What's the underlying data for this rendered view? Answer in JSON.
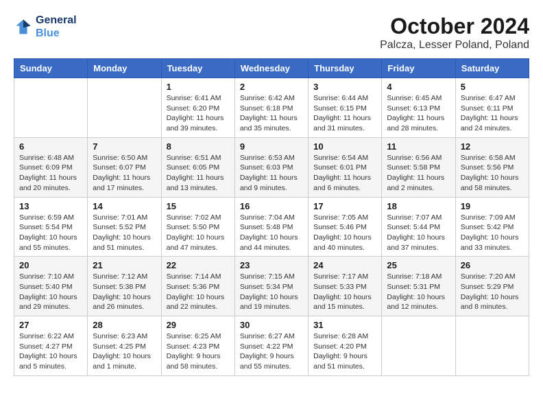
{
  "header": {
    "logo_line1": "General",
    "logo_line2": "Blue",
    "month_title": "October 2024",
    "location": "Palcza, Lesser Poland, Poland"
  },
  "columns": [
    "Sunday",
    "Monday",
    "Tuesday",
    "Wednesday",
    "Thursday",
    "Friday",
    "Saturday"
  ],
  "weeks": [
    [
      {
        "day": "",
        "info": ""
      },
      {
        "day": "",
        "info": ""
      },
      {
        "day": "1",
        "info": "Sunrise: 6:41 AM\nSunset: 6:20 PM\nDaylight: 11 hours and 39 minutes."
      },
      {
        "day": "2",
        "info": "Sunrise: 6:42 AM\nSunset: 6:18 PM\nDaylight: 11 hours and 35 minutes."
      },
      {
        "day": "3",
        "info": "Sunrise: 6:44 AM\nSunset: 6:15 PM\nDaylight: 11 hours and 31 minutes."
      },
      {
        "day": "4",
        "info": "Sunrise: 6:45 AM\nSunset: 6:13 PM\nDaylight: 11 hours and 28 minutes."
      },
      {
        "day": "5",
        "info": "Sunrise: 6:47 AM\nSunset: 6:11 PM\nDaylight: 11 hours and 24 minutes."
      }
    ],
    [
      {
        "day": "6",
        "info": "Sunrise: 6:48 AM\nSunset: 6:09 PM\nDaylight: 11 hours and 20 minutes."
      },
      {
        "day": "7",
        "info": "Sunrise: 6:50 AM\nSunset: 6:07 PM\nDaylight: 11 hours and 17 minutes."
      },
      {
        "day": "8",
        "info": "Sunrise: 6:51 AM\nSunset: 6:05 PM\nDaylight: 11 hours and 13 minutes."
      },
      {
        "day": "9",
        "info": "Sunrise: 6:53 AM\nSunset: 6:03 PM\nDaylight: 11 hours and 9 minutes."
      },
      {
        "day": "10",
        "info": "Sunrise: 6:54 AM\nSunset: 6:01 PM\nDaylight: 11 hours and 6 minutes."
      },
      {
        "day": "11",
        "info": "Sunrise: 6:56 AM\nSunset: 5:58 PM\nDaylight: 11 hours and 2 minutes."
      },
      {
        "day": "12",
        "info": "Sunrise: 6:58 AM\nSunset: 5:56 PM\nDaylight: 10 hours and 58 minutes."
      }
    ],
    [
      {
        "day": "13",
        "info": "Sunrise: 6:59 AM\nSunset: 5:54 PM\nDaylight: 10 hours and 55 minutes."
      },
      {
        "day": "14",
        "info": "Sunrise: 7:01 AM\nSunset: 5:52 PM\nDaylight: 10 hours and 51 minutes."
      },
      {
        "day": "15",
        "info": "Sunrise: 7:02 AM\nSunset: 5:50 PM\nDaylight: 10 hours and 47 minutes."
      },
      {
        "day": "16",
        "info": "Sunrise: 7:04 AM\nSunset: 5:48 PM\nDaylight: 10 hours and 44 minutes."
      },
      {
        "day": "17",
        "info": "Sunrise: 7:05 AM\nSunset: 5:46 PM\nDaylight: 10 hours and 40 minutes."
      },
      {
        "day": "18",
        "info": "Sunrise: 7:07 AM\nSunset: 5:44 PM\nDaylight: 10 hours and 37 minutes."
      },
      {
        "day": "19",
        "info": "Sunrise: 7:09 AM\nSunset: 5:42 PM\nDaylight: 10 hours and 33 minutes."
      }
    ],
    [
      {
        "day": "20",
        "info": "Sunrise: 7:10 AM\nSunset: 5:40 PM\nDaylight: 10 hours and 29 minutes."
      },
      {
        "day": "21",
        "info": "Sunrise: 7:12 AM\nSunset: 5:38 PM\nDaylight: 10 hours and 26 minutes."
      },
      {
        "day": "22",
        "info": "Sunrise: 7:14 AM\nSunset: 5:36 PM\nDaylight: 10 hours and 22 minutes."
      },
      {
        "day": "23",
        "info": "Sunrise: 7:15 AM\nSunset: 5:34 PM\nDaylight: 10 hours and 19 minutes."
      },
      {
        "day": "24",
        "info": "Sunrise: 7:17 AM\nSunset: 5:33 PM\nDaylight: 10 hours and 15 minutes."
      },
      {
        "day": "25",
        "info": "Sunrise: 7:18 AM\nSunset: 5:31 PM\nDaylight: 10 hours and 12 minutes."
      },
      {
        "day": "26",
        "info": "Sunrise: 7:20 AM\nSunset: 5:29 PM\nDaylight: 10 hours and 8 minutes."
      }
    ],
    [
      {
        "day": "27",
        "info": "Sunrise: 6:22 AM\nSunset: 4:27 PM\nDaylight: 10 hours and 5 minutes."
      },
      {
        "day": "28",
        "info": "Sunrise: 6:23 AM\nSunset: 4:25 PM\nDaylight: 10 hours and 1 minute."
      },
      {
        "day": "29",
        "info": "Sunrise: 6:25 AM\nSunset: 4:23 PM\nDaylight: 9 hours and 58 minutes."
      },
      {
        "day": "30",
        "info": "Sunrise: 6:27 AM\nSunset: 4:22 PM\nDaylight: 9 hours and 55 minutes."
      },
      {
        "day": "31",
        "info": "Sunrise: 6:28 AM\nSunset: 4:20 PM\nDaylight: 9 hours and 51 minutes."
      },
      {
        "day": "",
        "info": ""
      },
      {
        "day": "",
        "info": ""
      }
    ]
  ]
}
